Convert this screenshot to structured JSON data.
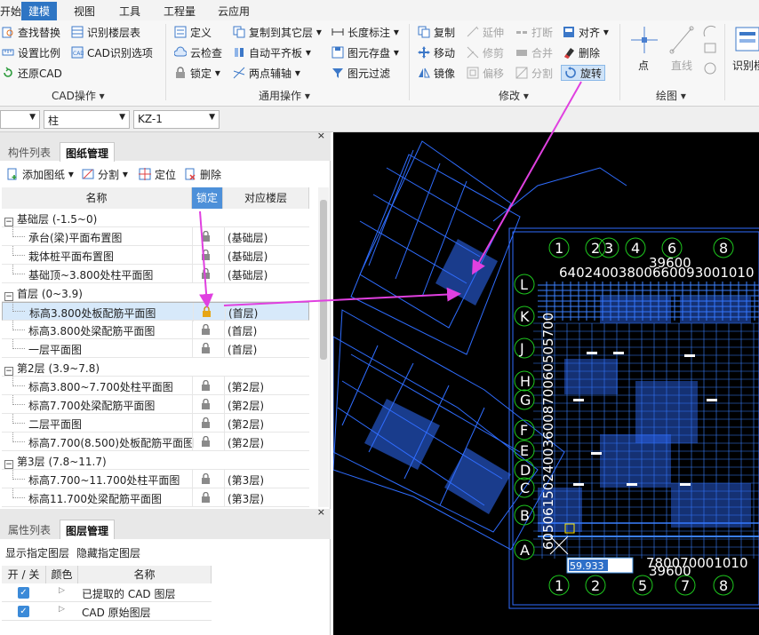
{
  "menubar": {
    "items": [
      "开始",
      "建模",
      "视图",
      "工具",
      "工程量",
      "云应用"
    ],
    "active_index": 1
  },
  "ribbon": {
    "cad_ops": [
      "查找替换",
      "识别楼层表",
      "设置比例",
      "CAD识别选项",
      "还原CAD"
    ],
    "cad_group": "CAD操作",
    "general_ops": [
      "定义",
      "复制到其它层",
      "长度标注",
      "云检查",
      "自动平齐板",
      "图元存盘",
      "锁定",
      "两点辅轴",
      "图元过滤"
    ],
    "general_group": "通用操作",
    "modify_ops": [
      "复制",
      "延伸",
      "打断",
      "对齐",
      "移动",
      "修剪",
      "合并",
      "删除",
      "镜像",
      "偏移",
      "分割",
      "旋转"
    ],
    "modify_group": "修改",
    "draw_ops": [
      "点",
      "直线"
    ],
    "draw_group": "绘图",
    "recognize_label": "识别楼"
  },
  "selectors": {
    "first": "",
    "component": "柱",
    "name": "KZ-1"
  },
  "drawing_panel": {
    "tabs": [
      "构件列表",
      "图纸管理"
    ],
    "active_tab": 1,
    "toolbar": [
      "添加图纸",
      "分割",
      "定位",
      "删除"
    ],
    "columns": [
      "名称",
      "锁定",
      "对应楼层"
    ],
    "rows": [
      {
        "type": "group",
        "name": "基础层 (-1.5~0)"
      },
      {
        "type": "item",
        "name": "承台(梁)平面布置图",
        "floor": "(基础层)"
      },
      {
        "type": "item",
        "name": "栽体桩平面布置图",
        "floor": "(基础层)"
      },
      {
        "type": "item",
        "name": "基础顶~3.800处柱平面图",
        "floor": "(基础层)"
      },
      {
        "type": "group",
        "name": "首层 (0~3.9)"
      },
      {
        "type": "item",
        "name": "标高3.800处板配筋平面图",
        "floor": "(首层)",
        "selected": true
      },
      {
        "type": "item",
        "name": "标高3.800处梁配筋平面图",
        "floor": "(首层)"
      },
      {
        "type": "item",
        "name": "一层平面图",
        "floor": "(首层)"
      },
      {
        "type": "group",
        "name": "第2层 (3.9~7.8)"
      },
      {
        "type": "item",
        "name": "标高3.800~7.700处柱平面图",
        "floor": "(第2层)"
      },
      {
        "type": "item",
        "name": "标高7.700处梁配筋平面图",
        "floor": "(第2层)"
      },
      {
        "type": "item",
        "name": "二层平面图",
        "floor": "(第2层)"
      },
      {
        "type": "item",
        "name": "标高7.700(8.500)处板配筋平面图",
        "floor": "(第2层)"
      },
      {
        "type": "group",
        "name": "第3层 (7.8~11.7)"
      },
      {
        "type": "item",
        "name": "标高7.700~11.700处柱平面图",
        "floor": "(第3层)"
      },
      {
        "type": "item",
        "name": "标高11.700处梁配筋平面图",
        "floor": "(第3层)"
      }
    ]
  },
  "layer_panel": {
    "tabs": [
      "属性列表",
      "图层管理"
    ],
    "active_tab": 1,
    "toolbar": [
      "显示指定图层",
      "隐藏指定图层"
    ],
    "columns": [
      "开 / 关",
      "颜色",
      "名称"
    ],
    "rows": [
      {
        "on": true,
        "name": "已提取的 CAD 图层"
      },
      {
        "on": true,
        "name": "CAD 原始图层"
      }
    ]
  },
  "canvas": {
    "top_axes": [
      "1",
      "2",
      "3",
      "4",
      "6",
      "8"
    ],
    "bottom_axes": [
      "1",
      "2",
      "5",
      "7",
      "8"
    ],
    "left_axes": [
      "L",
      "K",
      "J",
      "H",
      "G",
      "F",
      "E",
      "D",
      "C",
      "B",
      "A"
    ],
    "top_dims": [
      "640",
      "2400",
      "3800",
      "6600",
      "9300",
      "1010"
    ],
    "top_total": "39600",
    "bottom_dims": [
      "7800",
      "7000",
      "1010"
    ],
    "bottom_total": "39600",
    "left_dims": "6050615024003600870060505700",
    "input_value": "59.933",
    "colors": {
      "background": "#000000",
      "drawing": "#2f6dff",
      "arrow": "#e040e0",
      "grid_circle": "#1ec81e"
    }
  }
}
